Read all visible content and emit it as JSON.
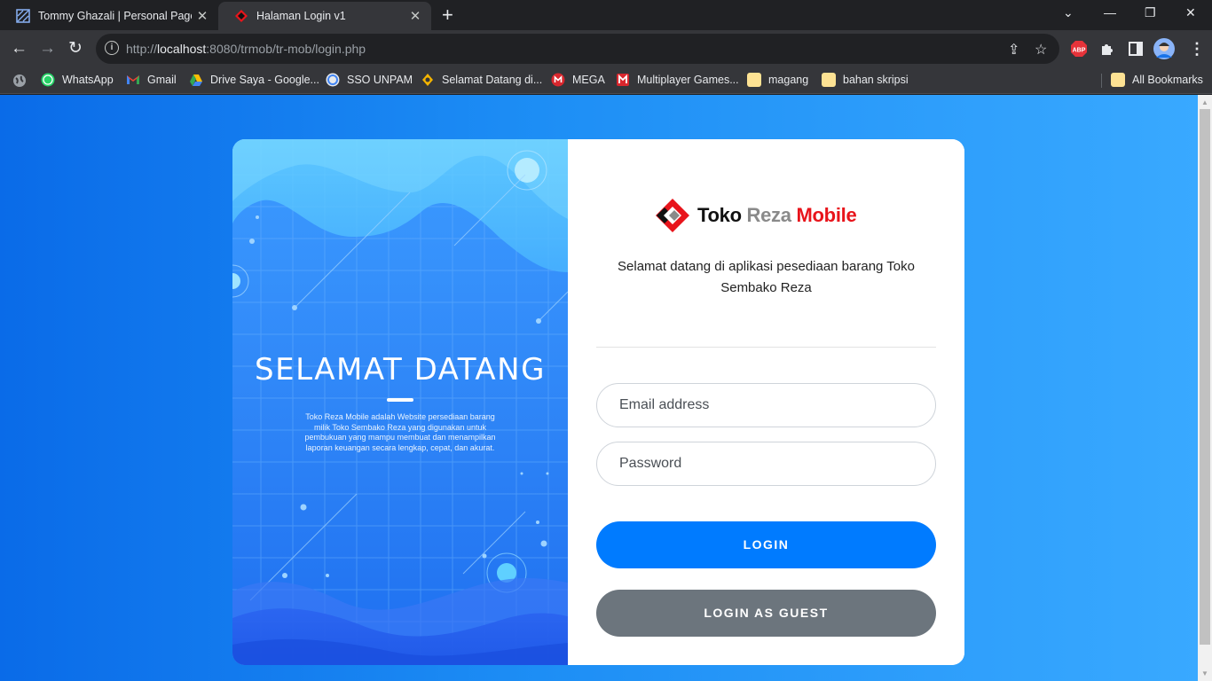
{
  "browser": {
    "tabs": [
      {
        "title": "Tommy Ghazali | Personal Pages",
        "active": false
      },
      {
        "title": "Halaman Login v1",
        "active": true
      }
    ],
    "url_host": "localhost",
    "url_prefix": "http://",
    "url_rest": ":8080/trmob/tr-mob/login.php",
    "bookmarks": [
      {
        "label": "WhatsApp",
        "color": "#25d366"
      },
      {
        "label": "Gmail",
        "color": "#ea4335"
      },
      {
        "label": "Drive Saya - Google...",
        "color": "#fbbc04"
      },
      {
        "label": "SSO UNPAM",
        "color": "#4285f4"
      },
      {
        "label": "Selamat Datang di...",
        "color": "#f4b400"
      },
      {
        "label": "MEGA",
        "color": "#d9272e"
      },
      {
        "label": "Multiplayer Games...",
        "color": "#d9272e"
      },
      {
        "label": "magang",
        "color": "#fde293"
      },
      {
        "label": "bahan skripsi",
        "color": "#fde293"
      }
    ],
    "all_bookmarks": "All Bookmarks",
    "extension_abp": "ABP"
  },
  "hero": {
    "title": "SELAMAT DATANG",
    "description": "Toko Reza Mobile adalah Website persediaan barang milik Toko Sembako Reza yang digunakan untuk pembukuan yang mampu membuat dan menampilkan laporan keuangan secara lengkap, cepat, dan akurat."
  },
  "login": {
    "logo_word1": "Toko",
    "logo_word2": "Reza",
    "logo_word3": "Mobile",
    "welcome": "Selamat datang di aplikasi pesediaan barang Toko Sembako Reza",
    "email_placeholder": "Email address",
    "password_placeholder": "Password",
    "login_button": "LOGIN",
    "guest_button": "LOGIN AS GUEST"
  },
  "colors": {
    "primary": "#007bff",
    "secondary": "#6c757d",
    "brand_red": "#e8141b"
  }
}
